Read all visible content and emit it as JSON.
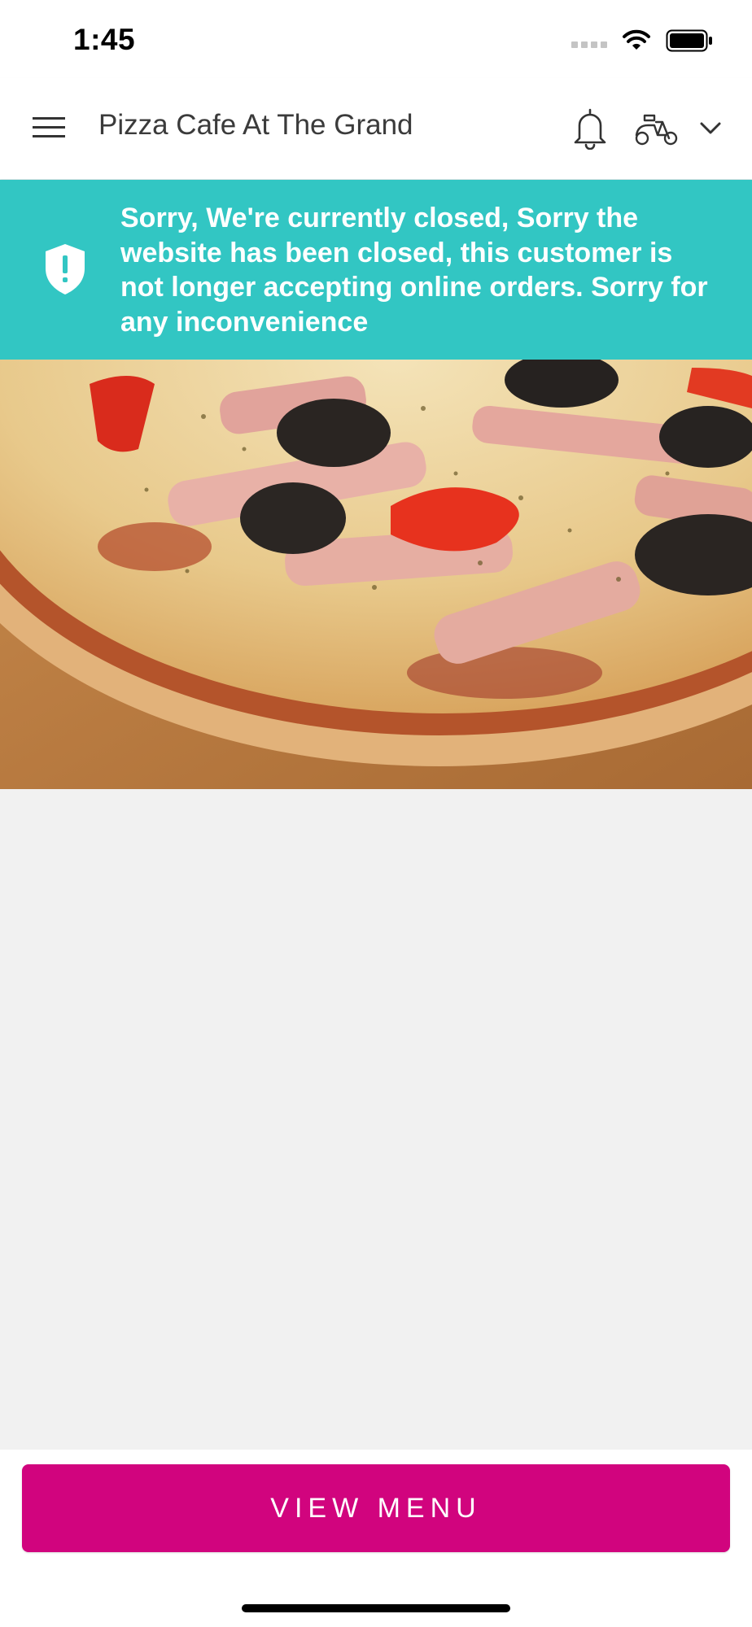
{
  "status_bar": {
    "time": "1:45"
  },
  "header": {
    "title": "Pizza Cafe At The Grand",
    "icons": [
      "hamburger-menu-icon",
      "bell-icon",
      "scooter-icon",
      "chevron-down-icon"
    ]
  },
  "banner": {
    "message": "Sorry, We're currently closed, Sorry the website has been closed, this customer is not longer accepting online orders. Sorry for any inconvenience",
    "icon": "shield-alert-icon",
    "background_color": "#32c6c3"
  },
  "hero": {
    "image": "pizza-photo"
  },
  "footer": {
    "view_menu_label": "VIEW MENU",
    "button_color": "#d1047e"
  }
}
